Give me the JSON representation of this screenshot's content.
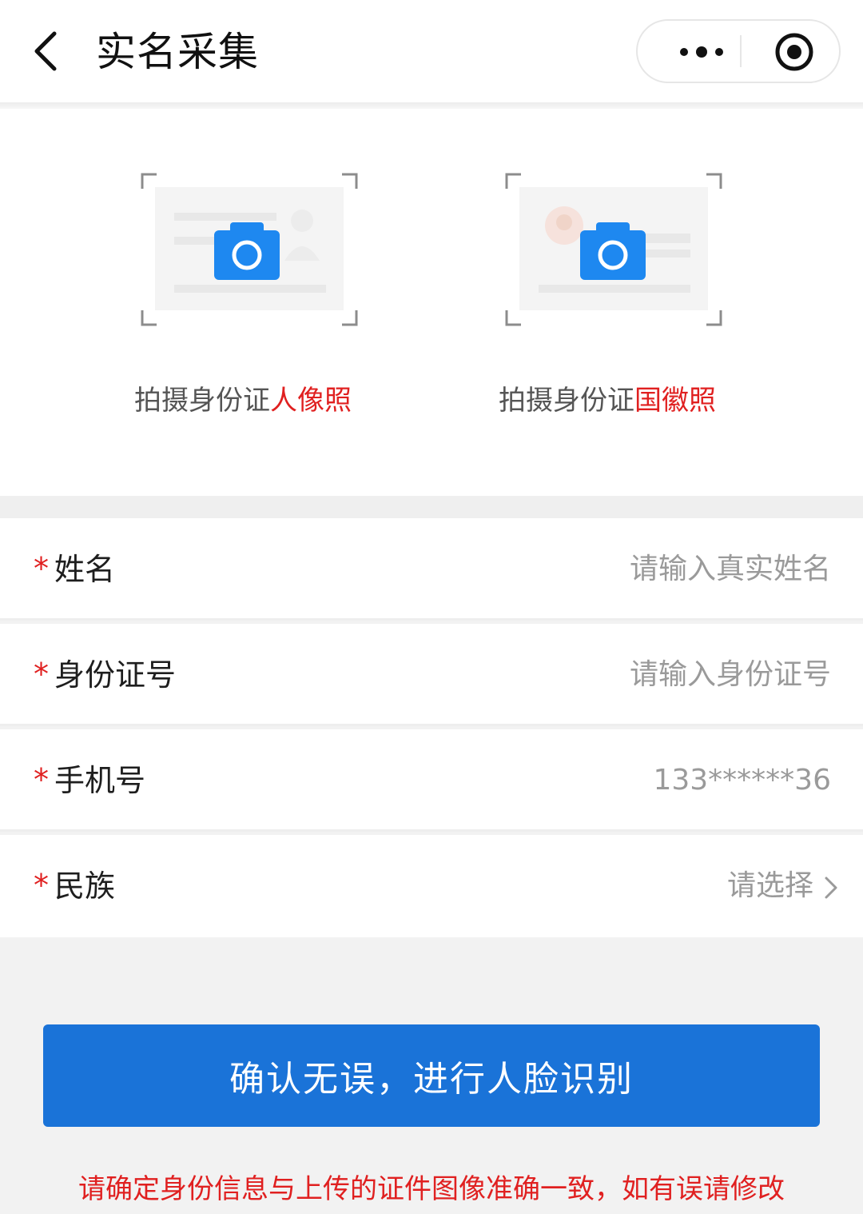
{
  "header": {
    "title": "实名采集",
    "back_icon": "chevron-left-icon",
    "more_icon": "more-dots-icon",
    "close_icon": "target-close-icon"
  },
  "upload": {
    "front": {
      "prefix": "拍摄身份证",
      "highlight": "人像照",
      "icon": "camera-icon"
    },
    "back": {
      "prefix": "拍摄身份证",
      "highlight": "国徽照",
      "icon": "camera-icon"
    }
  },
  "form": {
    "required_mark": "*",
    "name": {
      "label": "姓名",
      "placeholder": "请输入真实姓名"
    },
    "id_number": {
      "label": "身份证号",
      "placeholder": "请输入身份证号"
    },
    "phone": {
      "label": "手机号",
      "value": "133******36"
    },
    "ethnicity": {
      "label": "民族",
      "value": "请选择"
    }
  },
  "confirm_button": "确认无误，进行人脸识别",
  "notice": "请确定身份信息与上传的证件图像准确一致，如有误请修改",
  "colors": {
    "accent": "#1a73d8",
    "highlight": "#e02020",
    "camera": "#1e88f0"
  }
}
